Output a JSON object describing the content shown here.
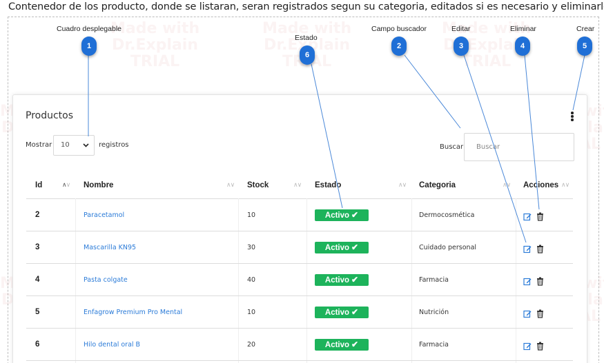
{
  "caption": "Contenedor de los producto, donde se listaran, seran registrados segun su categoria, editados si es necesario y eliminarlos",
  "watermark": "Made with\nDr.Explain\nTRIAL",
  "annotations": [
    {
      "number": "1",
      "label": "Cuadro desplegable"
    },
    {
      "number": "2",
      "label": "Campo buscador"
    },
    {
      "number": "3",
      "label": "Editar"
    },
    {
      "number": "4",
      "label": "Eliminar"
    },
    {
      "number": "5",
      "label": "Crear"
    },
    {
      "number": "6",
      "label": "Estado"
    }
  ],
  "colors": {
    "badge": "#1f6fd6",
    "leader_line": "#4a88d8",
    "status_active": "#1db35b",
    "link": "#2b7bd8",
    "action_icon": "#2b7bd8"
  },
  "card": {
    "title": "Productos",
    "menu_icon": "vertical-ellipsis-icon",
    "show_label": "Mostrar",
    "page_size": "10",
    "records_label": "registros",
    "search_label": "Buscar",
    "search_placeholder": "Buscar"
  },
  "table": {
    "headers": [
      "Id",
      "Nombre",
      "Stock",
      "Estado",
      "Categoria",
      "Acciones"
    ],
    "rows": [
      {
        "id": "2",
        "name": "Paracetamol",
        "stock": "10",
        "status": "Activo",
        "category": "Dermocosmética"
      },
      {
        "id": "3",
        "name": "Mascarilla KN95",
        "stock": "30",
        "status": "Activo",
        "category": "Cuidado personal"
      },
      {
        "id": "4",
        "name": "Pasta colgate",
        "stock": "40",
        "status": "Activo",
        "category": "Farmacia"
      },
      {
        "id": "5",
        "name": "Enfagrow Premium Pro Mental",
        "stock": "10",
        "status": "Activo",
        "category": "Nutrición"
      },
      {
        "id": "6",
        "name": "Hilo dental oral B",
        "stock": "20",
        "status": "Activo",
        "category": "Farmacia"
      }
    ]
  }
}
